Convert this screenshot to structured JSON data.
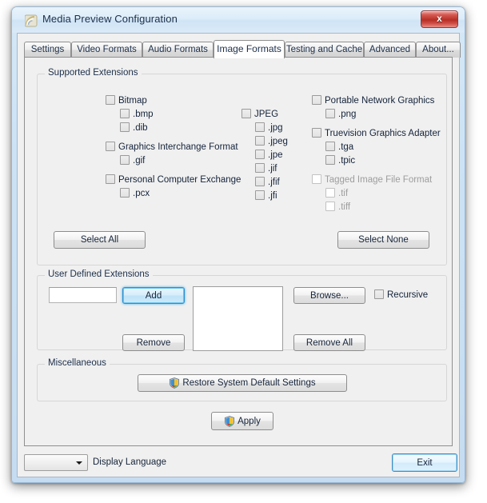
{
  "window": {
    "title": "Media Preview Configuration",
    "icon": "media-preview-app-icon",
    "close_label": "x"
  },
  "tabs": [
    {
      "label": "Settings",
      "active": false
    },
    {
      "label": "Video Formats",
      "active": false
    },
    {
      "label": "Audio Formats",
      "active": false
    },
    {
      "label": "Image Formats",
      "active": true
    },
    {
      "label": "Testing and Cache",
      "active": false
    },
    {
      "label": "Advanced",
      "active": false
    },
    {
      "label": "About...",
      "active": false
    }
  ],
  "supported_extensions": {
    "legend": "Supported Extensions",
    "column1": [
      {
        "label": "Bitmap",
        "checked": false,
        "disabled": false,
        "child": false
      },
      {
        "label": ".bmp",
        "checked": false,
        "disabled": false,
        "child": true
      },
      {
        "label": ".dib",
        "checked": false,
        "disabled": false,
        "child": true
      },
      {
        "label": "Graphics Interchange Format",
        "checked": false,
        "disabled": false,
        "child": false
      },
      {
        "label": ".gif",
        "checked": false,
        "disabled": false,
        "child": true
      },
      {
        "label": "Personal Computer Exchange",
        "checked": false,
        "disabled": false,
        "child": false
      },
      {
        "label": ".pcx",
        "checked": false,
        "disabled": false,
        "child": true
      }
    ],
    "column2": [
      {
        "label": "JPEG",
        "checked": false,
        "disabled": false,
        "child": false
      },
      {
        "label": ".jpg",
        "checked": false,
        "disabled": false,
        "child": true
      },
      {
        "label": ".jpeg",
        "checked": false,
        "disabled": false,
        "child": true
      },
      {
        "label": ".jpe",
        "checked": false,
        "disabled": false,
        "child": true
      },
      {
        "label": ".jif",
        "checked": false,
        "disabled": false,
        "child": true
      },
      {
        "label": ".jfif",
        "checked": false,
        "disabled": false,
        "child": true
      },
      {
        "label": ".jfi",
        "checked": false,
        "disabled": false,
        "child": true
      }
    ],
    "column3": [
      {
        "label": "Portable Network Graphics",
        "checked": false,
        "disabled": false,
        "child": false
      },
      {
        "label": ".png",
        "checked": false,
        "disabled": false,
        "child": true
      },
      {
        "label": "Truevision Graphics Adapter",
        "checked": false,
        "disabled": false,
        "child": false
      },
      {
        "label": ".tga",
        "checked": false,
        "disabled": false,
        "child": true
      },
      {
        "label": ".tpic",
        "checked": false,
        "disabled": false,
        "child": true
      },
      {
        "label": "Tagged Image File Format",
        "checked": false,
        "disabled": true,
        "child": false
      },
      {
        "label": ".tif",
        "checked": false,
        "disabled": true,
        "child": true
      },
      {
        "label": ".tiff",
        "checked": false,
        "disabled": true,
        "child": true
      }
    ],
    "select_all": "Select All",
    "select_none": "Select None"
  },
  "user_defined": {
    "legend": "User Defined Extensions",
    "input_value": "",
    "input_placeholder": "",
    "add": "Add",
    "remove": "Remove",
    "browse": "Browse...",
    "remove_all": "Remove All",
    "recursive": "Recursive",
    "recursive_checked": false,
    "list_items": []
  },
  "miscellaneous": {
    "legend": "Miscellaneous",
    "restore": "Restore System Default Settings",
    "apply": "Apply"
  },
  "bottom": {
    "language_value": "",
    "language_label": "Display Language",
    "exit": "Exit"
  }
}
